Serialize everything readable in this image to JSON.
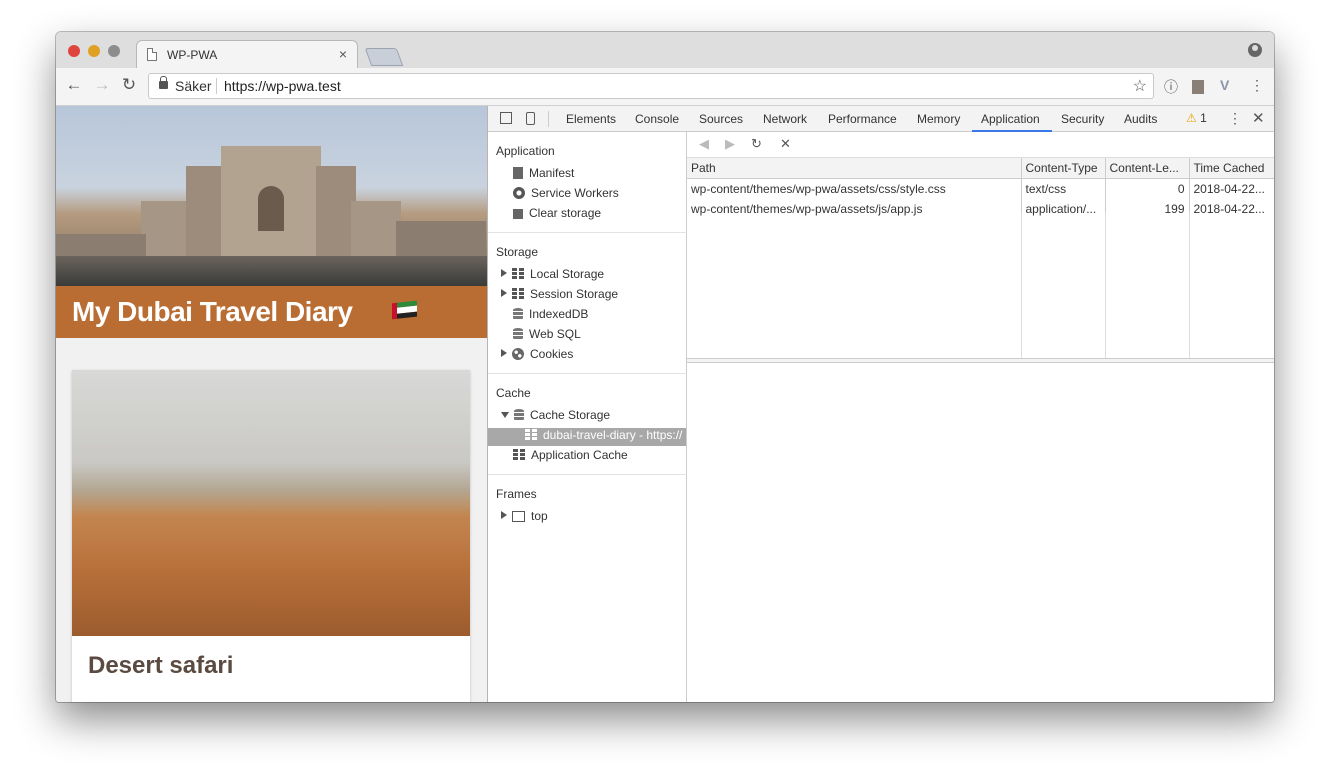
{
  "browser": {
    "tab_title": "WP-PWA",
    "tab_close": "×",
    "secure_label": "Säker",
    "url": "https://wp-pwa.test",
    "back": "←",
    "forward": "→",
    "reload": "↻",
    "star": "☆",
    "ext_i": "ⓘ",
    "ext_v": "V",
    "menu": "⋮"
  },
  "page": {
    "banner_title": "My Dubai Travel Diary",
    "card_title": "Desert safari",
    "flag_colors": [
      "#2d8a3a",
      "#ffffff",
      "#222222",
      "#c8102e"
    ]
  },
  "devtools": {
    "tabs": [
      "Elements",
      "Console",
      "Sources",
      "Network",
      "Performance",
      "Memory",
      "Application",
      "Security",
      "Audits"
    ],
    "active_tab": "Application",
    "warning_count": "1",
    "sidebar": {
      "application": {
        "heading": "Application",
        "items": [
          "Manifest",
          "Service Workers",
          "Clear storage"
        ]
      },
      "storage": {
        "heading": "Storage",
        "items": [
          "Local Storage",
          "Session Storage",
          "IndexedDB",
          "Web SQL",
          "Cookies"
        ]
      },
      "cache": {
        "heading": "Cache",
        "items": [
          "Cache Storage",
          "dubai-travel-diary - https://",
          "Application Cache"
        ]
      },
      "frames": {
        "heading": "Frames",
        "items": [
          "top"
        ]
      }
    },
    "toolbar": {
      "prev": "◀",
      "next": "▶",
      "refresh": "↻",
      "delete": "✕"
    },
    "table": {
      "columns": [
        "Path",
        "Content-Type",
        "Content-Le...",
        "Time Cached"
      ],
      "rows": [
        {
          "path": "wp-content/themes/wp-pwa/assets/css/style.css",
          "type": "text/css",
          "length": "0",
          "time": "2018-04-22..."
        },
        {
          "path": "wp-content/themes/wp-pwa/assets/js/app.js",
          "type": "application/...",
          "length": "199",
          "time": "2018-04-22..."
        }
      ]
    }
  }
}
